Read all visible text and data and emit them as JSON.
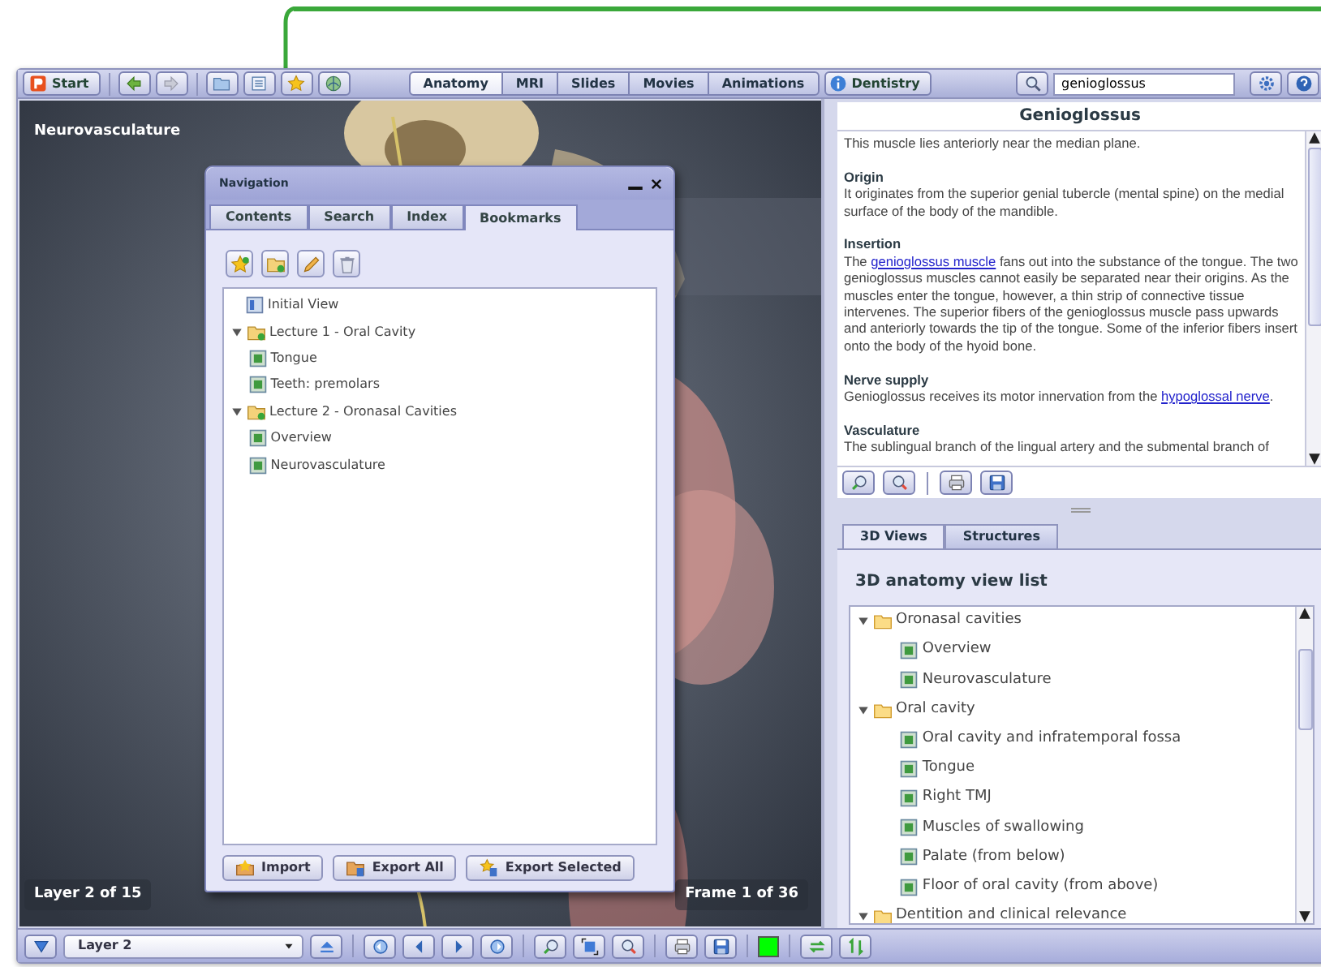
{
  "toolbar": {
    "start_button": "Start",
    "tabs": [
      {
        "label": "Anatomy",
        "selected": true
      },
      {
        "label": "MRI",
        "selected": false
      },
      {
        "label": "Slides",
        "selected": false
      },
      {
        "label": "Movies",
        "selected": false
      },
      {
        "label": "Animations",
        "selected": false
      }
    ],
    "dentistry_button": "Dentistry",
    "search": {
      "value": "genioglossus"
    }
  },
  "viewer": {
    "title": "Neurovasculature",
    "layer_label": "Layer 2 of 15",
    "frame_label": "Frame 1 of 36"
  },
  "navigation": {
    "title": "Navigation",
    "tabs": [
      {
        "label": "Contents",
        "selected": false
      },
      {
        "label": "Search",
        "selected": false
      },
      {
        "label": "Index",
        "selected": false
      },
      {
        "label": "Bookmarks",
        "selected": true
      }
    ],
    "tree": [
      {
        "kind": "start",
        "label": "Initial View"
      },
      {
        "kind": "folder",
        "label": "Lecture 1 - Oral Cavity",
        "expanded": true,
        "children": [
          {
            "kind": "view",
            "label": "Tongue"
          },
          {
            "kind": "view",
            "label": "Teeth: premolars"
          }
        ]
      },
      {
        "kind": "folder",
        "label": "Lecture 2 - Oronasal Cavities",
        "expanded": true,
        "children": [
          {
            "kind": "view",
            "label": "Overview"
          },
          {
            "kind": "view",
            "label": "Neurovasculature"
          }
        ]
      }
    ],
    "buttons": [
      "Import",
      "Export All",
      "Export Selected"
    ]
  },
  "info": {
    "title": "Genioglossus",
    "sections": [
      {
        "body": [
          {
            "text": "This muscle lies anteriorly near the median plane."
          }
        ]
      },
      {
        "heading": "Origin",
        "body": [
          {
            "text": "It originates from the superior genial tubercle (mental spine) on the medial surface of the body of the mandible."
          }
        ]
      },
      {
        "heading": "Insertion",
        "body": [
          {
            "text": "The "
          },
          {
            "text": "genioglossus muscle",
            "link": true
          },
          {
            "text": " fans out into the substance of the tongue. The two genioglossus muscles cannot easily be separated near their origins. As the muscles enter the tongue, however, a thin strip of connective tissue intervenes. The superior fibers of the genioglossus muscle pass upwards and anteriorly towards the tip of the tongue. Some of the inferior fibers insert onto the body of the hyoid bone."
          }
        ]
      },
      {
        "heading": "Nerve supply",
        "body": [
          {
            "text": "Genioglossus receives its motor innervation from the "
          },
          {
            "text": "hypoglossal nerve",
            "link": true
          },
          {
            "text": "."
          }
        ]
      },
      {
        "heading": "Vasculature",
        "body": [
          {
            "text": "The sublingual branch of the lingual artery and the submental branch of"
          }
        ]
      }
    ]
  },
  "views": {
    "tabs": [
      {
        "label": "3D Views",
        "selected": true
      },
      {
        "label": "Structures",
        "selected": false
      }
    ],
    "heading": "3D anatomy view list",
    "tree": [
      {
        "kind": "folder",
        "label": "Oronasal cavities",
        "expanded": true,
        "children": [
          {
            "kind": "view",
            "label": "Overview"
          },
          {
            "kind": "view",
            "label": "Neurovasculature"
          }
        ]
      },
      {
        "kind": "folder",
        "label": "Oral cavity",
        "expanded": true,
        "children": [
          {
            "kind": "view",
            "label": "Oral cavity and infratemporal fossa"
          },
          {
            "kind": "view",
            "label": "Tongue"
          },
          {
            "kind": "view",
            "label": "Right TMJ"
          },
          {
            "kind": "view",
            "label": "Muscles of swallowing"
          },
          {
            "kind": "view",
            "label": "Palate (from below)"
          },
          {
            "kind": "view",
            "label": "Floor of oral cavity (from above)"
          }
        ]
      },
      {
        "kind": "folder",
        "label": "Dentition and clinical relevance",
        "expanded": true
      }
    ]
  },
  "bottom_bar": {
    "layer_select": "Layer 2",
    "color_picker": {
      "color": "#00ff00"
    }
  }
}
